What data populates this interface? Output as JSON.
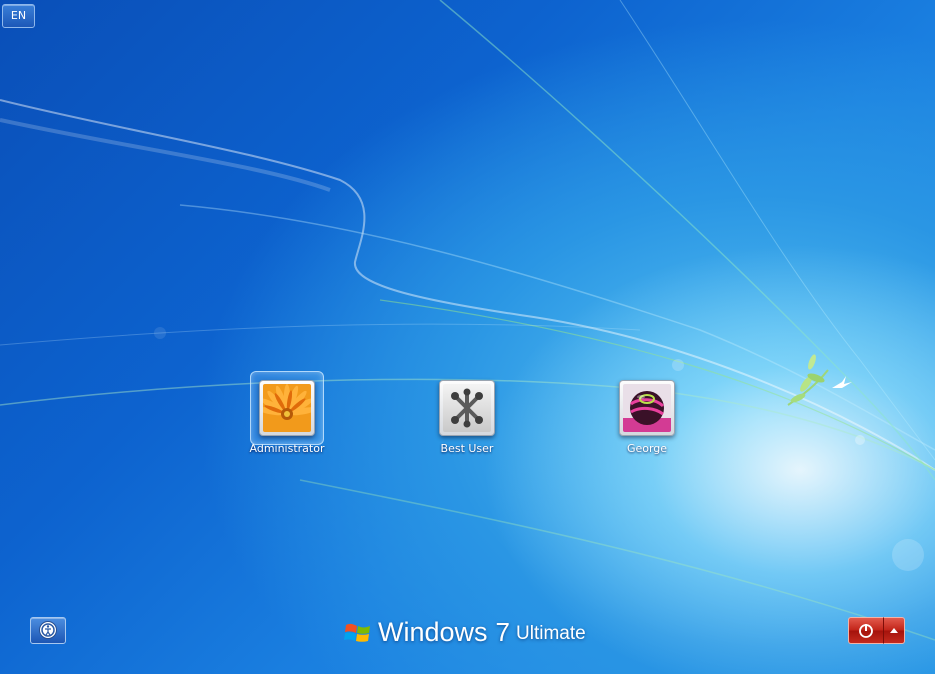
{
  "language_indicator": {
    "label": "EN"
  },
  "users": [
    {
      "name": "Administrator",
      "picture": "orange-flower-icon",
      "selected": true
    },
    {
      "name": "Best User",
      "picture": "metal-jacks-icon",
      "selected": false
    },
    {
      "name": "George",
      "picture": "pink-ball-icon",
      "selected": false
    }
  ],
  "branding": {
    "product": "Windows",
    "version": "7",
    "edition": "Ultimate"
  },
  "bottom_bar": {
    "ease_of_access_icon": "ease-of-access-icon",
    "shutdown_icon": "power-icon",
    "shutdown_options_icon": "triangle-up-icon"
  },
  "colors": {
    "background": "#0d63cf",
    "shutdown_button": "#c2251a"
  }
}
